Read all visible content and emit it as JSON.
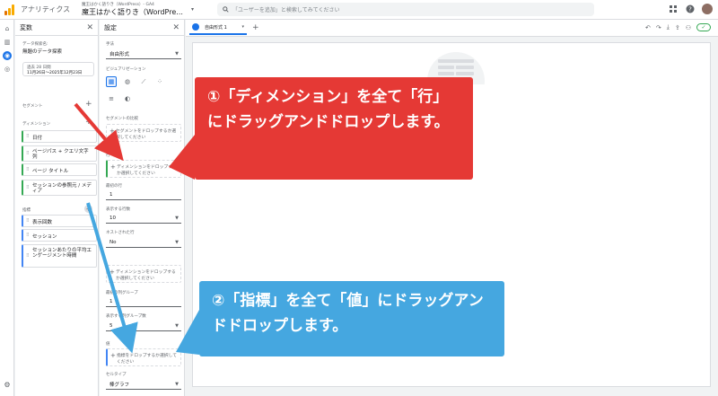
{
  "topbar": {
    "app_title": "アナリティクス",
    "account": "魔王はかく語りき（WordPress）- GA4",
    "property": "魔王はかく語りき（WordPre...",
    "search_placeholder": "「ユーザーを追加」と検索してみてください"
  },
  "variables_panel": {
    "title": "変数",
    "exploration_name_label": "データ探索名:",
    "exploration_name": "無題のデータ探索",
    "date_label": "過去 28 日間",
    "date_range": "11月26日～2025年12月23日",
    "segments_label": "セグメント",
    "dimensions_label": "ディメンション",
    "dimensions": [
      "日付",
      "ページパス + クエリ文字列",
      "ページ タイトル",
      "セッションの参照元 / メディア"
    ],
    "metrics_label": "指標",
    "metrics": [
      "表示回数",
      "セッション",
      "セッションあたりの平均エンゲージメント時間"
    ]
  },
  "settings_panel": {
    "title": "設定",
    "technique_label": "手法",
    "technique": "自由形式",
    "viz_label": "ビジュアリゼーション",
    "segment_compare_label": "セグメントの比較",
    "segment_drop": "セグメントをドロップするか選択してください",
    "rows_label": "行",
    "rows_drop": "ディメンションをドロップするか選択してください",
    "start_row_label": "最初の行",
    "start_row": "1",
    "show_rows_label": "表示する行数",
    "show_rows": "10",
    "nested_rows_label": "ネストされた行",
    "nested_rows": "No",
    "columns_drop": "ディメンションをドロップするか選択してください",
    "start_col_group_label": "最初の列グループ",
    "start_col_group": "1",
    "show_col_groups_label": "表示する列グループ数",
    "show_col_groups": "5",
    "values_label": "値",
    "values_drop": "指標をドロップするか選択してください",
    "cell_type_label": "セルタイプ",
    "cell_type": "棒グラフ"
  },
  "canvas": {
    "tab_name": "自由形式 1"
  },
  "callouts": {
    "step1": "①「ディメンション」を全て「行」にドラッグアンドドロップします。",
    "step2": "②「指標」を全て「値」にドラッグアンドドロップします。"
  },
  "colors": {
    "red_callout": "#e53935",
    "blue_callout": "#45a7e0",
    "dimension_accent": "#34a853",
    "metric_accent": "#4285f4",
    "brand_blue": "#1a73e8"
  }
}
